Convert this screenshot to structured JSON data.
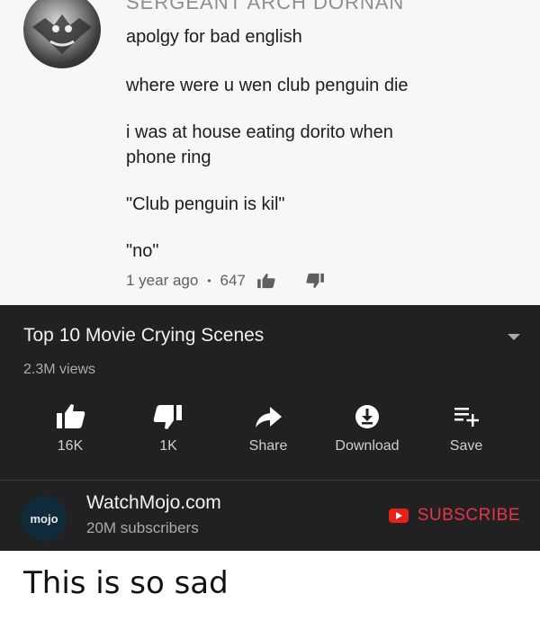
{
  "comment": {
    "author": "SERGEANT ARCH DORNAN",
    "lines": [
      "apolgy for bad english",
      "where were u wen club penguin die",
      "i was at house eating dorito when",
      "phone ring",
      "\"Club penguin is kil\"",
      "\"no\""
    ],
    "time": "1 year ago",
    "separator": "•",
    "likes": "647",
    "icons": [
      "thumbs-up-icon",
      "thumbs-down-icon"
    ]
  },
  "video": {
    "title": "Top 10 Movie Crying Scenes",
    "views": "2.3M views",
    "actions": [
      {
        "label": "16K",
        "icon": "thumbs-up-icon"
      },
      {
        "label": "1K",
        "icon": "thumbs-down-icon"
      },
      {
        "label": "Share",
        "icon": "share-icon"
      },
      {
        "label": "Download",
        "icon": "download-icon"
      },
      {
        "label": "Save",
        "icon": "add-to-playlist-icon"
      }
    ],
    "channel": {
      "logo_text": "mojo",
      "name": "WatchMojo.com",
      "subscribers": "20M subscribers",
      "subscribe_label": "SUBSCRIBE"
    }
  },
  "caption": "This is so sad",
  "colors": {
    "panel_bg": "#212121",
    "subscribe": "#e8334a",
    "comment_bg": "#f7f7f7"
  }
}
